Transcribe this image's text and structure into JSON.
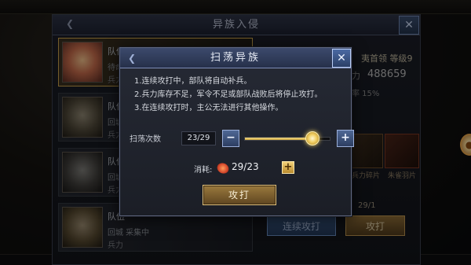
{
  "background_panel": {
    "title": "异族入侵",
    "troops": [
      {
        "name": "队伍",
        "status": "待命中",
        "power_label": "兵力"
      },
      {
        "name": "队伍",
        "status": "回城中",
        "power_label": "兵力"
      },
      {
        "name": "队伍",
        "status": "回城中",
        "power_label": "兵力"
      },
      {
        "name": "队伍",
        "status": "回城 采集中",
        "power_label": "兵力"
      }
    ],
    "enemy": {
      "title": "夷首领 等级9",
      "power_label": "力",
      "power": "488659",
      "rate": "率 15%"
    },
    "rewards": [
      {
        "label": "兵力碎片"
      },
      {
        "label": "朱雀羽片"
      }
    ],
    "cost": "29/1",
    "continuous_attack_label": "连续攻打",
    "attack_label": "攻打"
  },
  "modal": {
    "title": "扫荡异族",
    "rules": [
      "1.连续攻打中，部队将自动补兵。",
      "2.兵力库存不足，军令不足或部队战败后将停止攻打。",
      "3.在连续攻打时，主公无法进行其他操作。"
    ],
    "sweep": {
      "label": "扫荡次数",
      "count": "23/29",
      "current": 23,
      "max": 29
    },
    "cost": {
      "label": "消耗:",
      "value": "29/23"
    },
    "attack_label": "攻打"
  },
  "icons": {
    "back": "chevron-left-icon",
    "close": "crossed-swords-close-icon",
    "minus": "minus-icon",
    "plus": "plus-icon",
    "cost": "military-order-icon"
  },
  "colors": {
    "accent_gold": "#c9a23d",
    "header_blue": "#3c4a6c"
  }
}
